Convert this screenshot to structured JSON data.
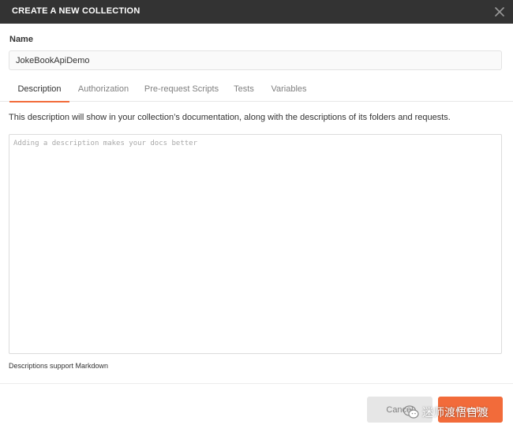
{
  "dialog": {
    "title": "CREATE A NEW COLLECTION",
    "close_icon": "close-icon"
  },
  "name_field": {
    "label": "Name",
    "value": "JokeBookApiDemo"
  },
  "tabs": [
    {
      "label": "Description",
      "active": true
    },
    {
      "label": "Authorization",
      "active": false
    },
    {
      "label": "Pre-request Scripts",
      "active": false
    },
    {
      "label": "Tests",
      "active": false
    },
    {
      "label": "Variables",
      "active": false
    }
  ],
  "description": {
    "info": "This description will show in your collection’s documentation, along with the descriptions of its folders and requests.",
    "placeholder": "Adding a description makes your docs better",
    "value": "",
    "markdown_note": "Descriptions support Markdown"
  },
  "footer": {
    "cancel_label": "Cancel",
    "create_label": "Create"
  },
  "watermark": {
    "icon": "wechat-icon",
    "text": "迷师渡悟自渡"
  },
  "colors": {
    "header_bg": "#333333",
    "accent": "#f26b3a",
    "cancel_bg": "#e6e6e6"
  }
}
